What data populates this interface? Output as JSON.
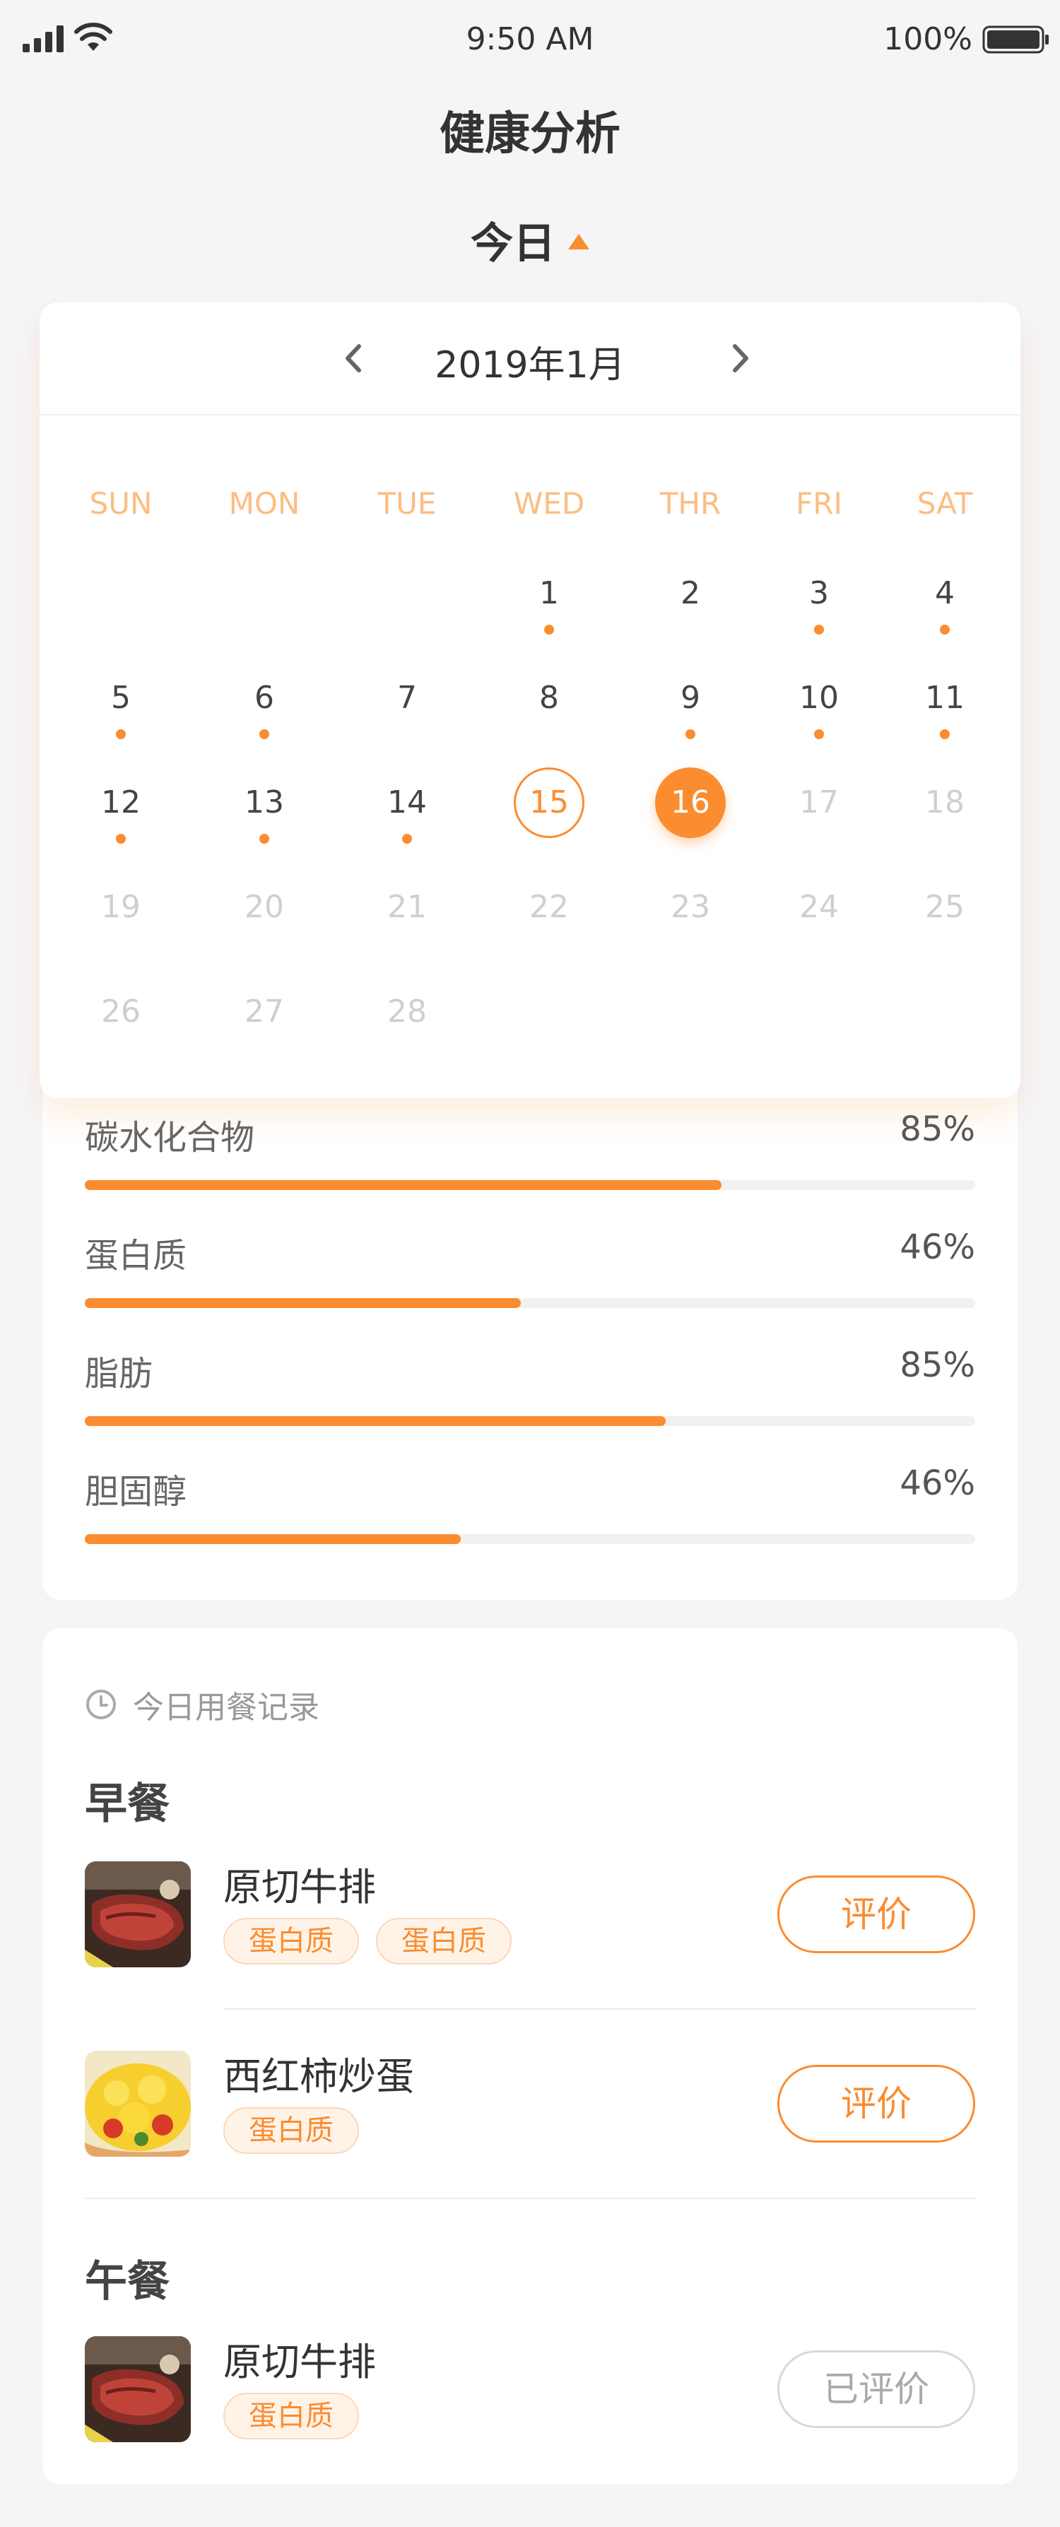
{
  "status_bar": {
    "time": "9:50 AM",
    "battery": "100%"
  },
  "page_title": "健康分析",
  "period": {
    "label": "今日"
  },
  "calendar": {
    "month_label": "2019年1月",
    "weekdays": [
      "SUN",
      "MON",
      "TUE",
      "WED",
      "THR",
      "FRI",
      "SAT"
    ],
    "days": [
      {
        "n": "1",
        "dot": true
      },
      {
        "n": "2",
        "dot": false
      },
      {
        "n": "3",
        "dot": true
      },
      {
        "n": "4",
        "dot": true
      },
      {
        "n": "5",
        "dot": true
      },
      {
        "n": "6",
        "dot": true
      },
      {
        "n": "7",
        "dot": false
      },
      {
        "n": "8",
        "dot": false
      },
      {
        "n": "9",
        "dot": true
      },
      {
        "n": "10",
        "dot": true
      },
      {
        "n": "11",
        "dot": true
      },
      {
        "n": "12",
        "dot": true
      },
      {
        "n": "13",
        "dot": true
      },
      {
        "n": "14",
        "dot": true
      },
      {
        "n": "15",
        "dot": false,
        "state": "today"
      },
      {
        "n": "16",
        "dot": false,
        "state": "selected"
      },
      {
        "n": "17",
        "dot": false,
        "state": "future"
      },
      {
        "n": "18",
        "dot": false,
        "state": "future"
      },
      {
        "n": "19",
        "dot": false,
        "state": "future"
      },
      {
        "n": "20",
        "dot": false,
        "state": "future"
      },
      {
        "n": "21",
        "dot": false,
        "state": "future"
      },
      {
        "n": "22",
        "dot": false,
        "state": "future"
      },
      {
        "n": "23",
        "dot": false,
        "state": "future"
      },
      {
        "n": "24",
        "dot": false,
        "state": "future"
      },
      {
        "n": "25",
        "dot": false,
        "state": "future"
      },
      {
        "n": "26",
        "dot": false,
        "state": "future"
      },
      {
        "n": "27",
        "dot": false,
        "state": "future"
      },
      {
        "n": "28",
        "dot": false,
        "state": "future"
      }
    ],
    "first_weekday": 3
  },
  "nutrition": [
    {
      "name": "碳水化合物",
      "percent_label": "85%",
      "fill": 0.715
    },
    {
      "name": "蛋白质",
      "percent_label": "46%",
      "fill": 0.49
    },
    {
      "name": "脂肪",
      "percent_label": "85%",
      "fill": 0.652
    },
    {
      "name": "胆固醇",
      "percent_label": "46%",
      "fill": 0.422
    }
  ],
  "meals": {
    "header": "今日用餐记录",
    "breakfast": {
      "title": "早餐",
      "items": [
        {
          "name": "原切牛排",
          "tags": [
            "蛋白质",
            "蛋白质"
          ],
          "action": "评价"
        },
        {
          "name": "西红柿炒蛋",
          "tags": [
            "蛋白质"
          ],
          "action": "评价"
        }
      ]
    },
    "lunch": {
      "title": "午餐",
      "items": [
        {
          "name": "原切牛排",
          "tags": [
            "蛋白质"
          ],
          "action": "已评价"
        }
      ]
    }
  },
  "colors": {
    "accent": "#fb8c2f",
    "weekday": "#fcbd83",
    "tag_bg": "#fff3e8"
  },
  "icons": [
    "signal-icon",
    "wifi-icon",
    "battery-icon",
    "caret-up-icon",
    "chevron-left-icon",
    "chevron-right-icon",
    "clock-icon"
  ]
}
